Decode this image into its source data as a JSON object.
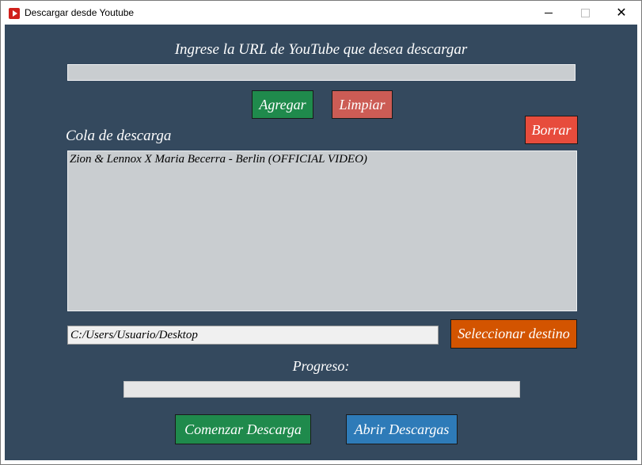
{
  "window": {
    "title": "Descargar desde Youtube",
    "icon": "youtube-icon",
    "controls": {
      "minimize": "minimize-icon",
      "maximize": "maximize-icon",
      "close": "✕"
    }
  },
  "url_section": {
    "label": "Ingrese la URL de YouTube que desea descargar",
    "value": ""
  },
  "buttons": {
    "add": "Agregar",
    "clear": "Limpiar",
    "delete": "Borrar",
    "select_destination": "Seleccionar destino",
    "start_download": "Comenzar Descarga",
    "open_downloads": "Abrir Descargas"
  },
  "queue": {
    "label": "Cola de descarga",
    "items": [
      "Zion & Lennox X Maria Becerra - Berlin (OFFICIAL VIDEO)"
    ]
  },
  "destination": {
    "path": "C:/Users/Usuario/Desktop"
  },
  "progress": {
    "label": "Progreso:",
    "fraction": 0
  },
  "colors": {
    "background": "#34495e",
    "green": "#1f8a4c",
    "clear_red": "#cc5c55",
    "delete_red": "#e74c3c",
    "orange": "#d35400",
    "blue": "#2e7bb8"
  }
}
